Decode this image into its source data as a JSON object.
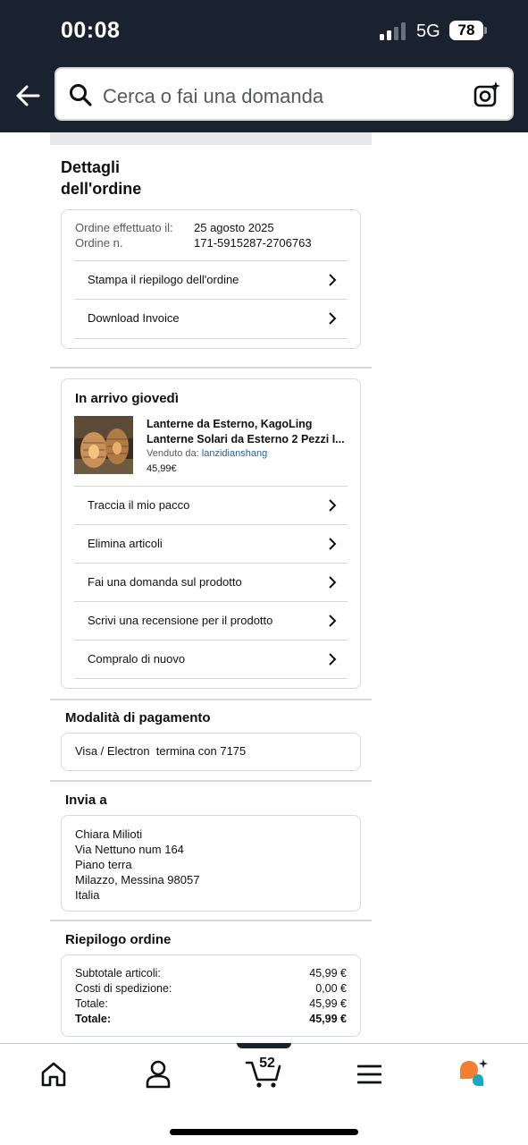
{
  "status_bar": {
    "time": "00:08",
    "network": "5G",
    "battery": "78"
  },
  "search": {
    "placeholder": "Cerca o fai una domanda"
  },
  "order_details": {
    "title_line1": "Dettagli",
    "title_line2": "dell'ordine",
    "placed_label": "Ordine effettuato il:",
    "placed_value": "25 agosto 2025",
    "number_label": "Ordine n.",
    "number_value": "171-5915287-2706763",
    "actions": [
      "Stampa il riepilogo dell'ordine",
      "Download Invoice"
    ]
  },
  "shipment": {
    "heading": "In arrivo giovedì",
    "product_title_line1": "Lanterne da Esterno, KagoLing",
    "product_title_line2": "Lanterne Solari da Esterno 2 Pezzi I...",
    "sold_by_label": "Venduto da:",
    "seller": "lanzidianshang",
    "price": "45,99€",
    "actions": [
      "Traccia il mio pacco",
      "Elimina articoli",
      "Fai una domanda sul prodotto",
      "Scrivi una recensione per il prodotto",
      "Compralo di nuovo"
    ]
  },
  "payment": {
    "heading": "Modalità di pagamento",
    "method": "Visa / Electron  termina con 7175"
  },
  "ship_to": {
    "heading": "Invia a",
    "lines": [
      "Chiara Milioti",
      "Via Nettuno num 164",
      "Piano terra",
      "Milazzo, Messina 98057",
      "Italia"
    ]
  },
  "summary": {
    "heading": "Riepilogo ordine",
    "rows": [
      {
        "label": "Subtotale articoli:",
        "value": "45,99 €"
      },
      {
        "label": "Costi di spedizione:",
        "value": "0,00 €"
      },
      {
        "label": "Totale:",
        "value": "45,99 €"
      },
      {
        "label": "Totale:",
        "value": "45,99 €"
      }
    ]
  },
  "bottom_nav": {
    "cart_count": "52",
    "icons": [
      "home-icon",
      "account-icon",
      "cart-icon",
      "menu-icon",
      "rufus-ai-icon"
    ]
  },
  "colors": {
    "header_bg": "#1a2230",
    "link": "#2162a1",
    "border": "#d5d9d9",
    "rufus_orange": "#f08030",
    "rufus_teal": "#1fa6c0"
  }
}
